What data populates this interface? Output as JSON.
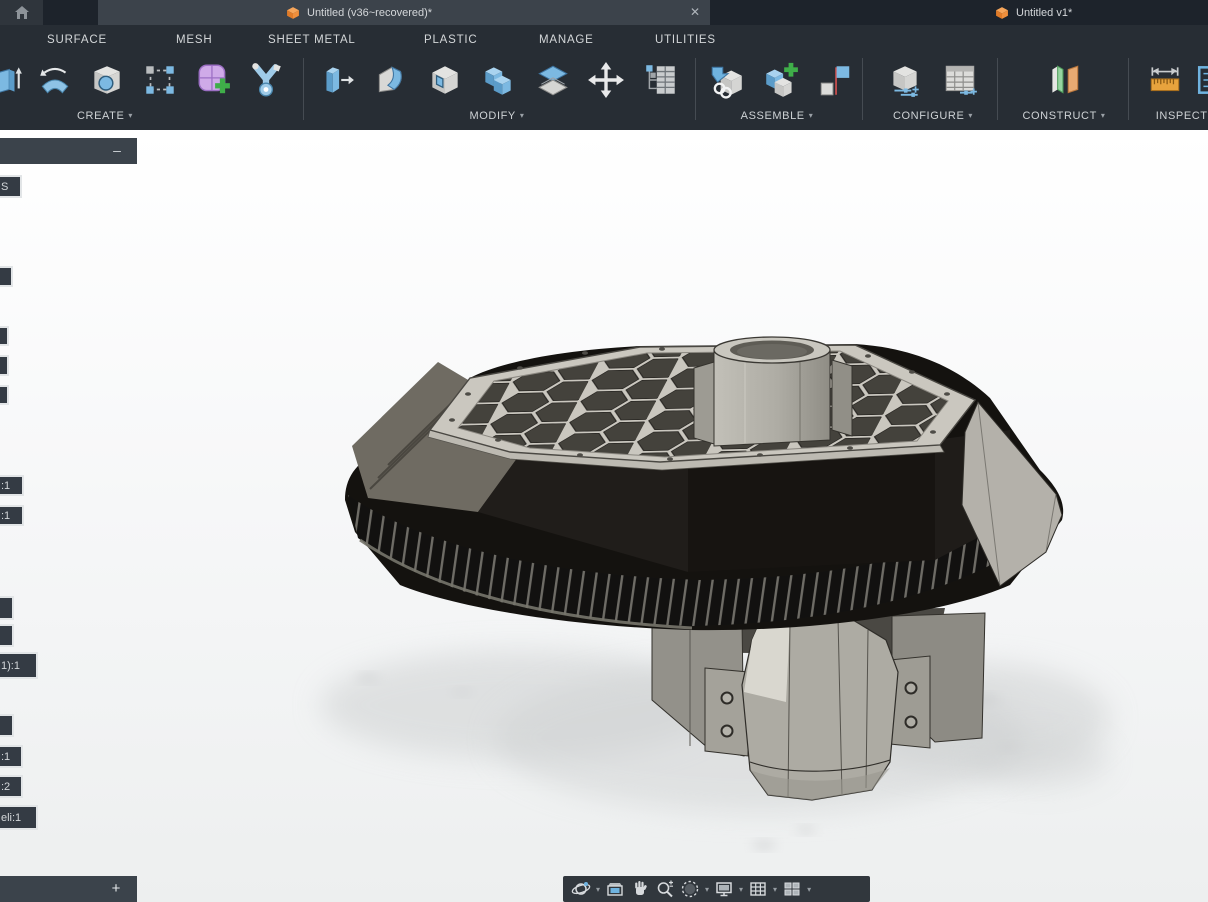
{
  "tabbar": {
    "tabs": [
      {
        "title": "Untitled (v36~recovered)*",
        "active": true,
        "close": "✕"
      },
      {
        "title": "Untitled v1*",
        "active": false
      }
    ]
  },
  "menubar": {
    "items": [
      "SURFACE",
      "MESH",
      "SHEET METAL",
      "PLASTIC",
      "MANAGE",
      "UTILITIES"
    ]
  },
  "toolbar": {
    "caret": "▾",
    "groups": [
      {
        "label": "CREATE",
        "icons": [
          "extrude-icon",
          "revolve-icon",
          "hole-icon",
          "rectangular-pattern-icon",
          "form-icon",
          "generative-design-icon"
        ]
      },
      {
        "label": "MODIFY",
        "icons": [
          "press-pull-icon",
          "fillet-icon",
          "shell-icon",
          "combine-icon",
          "offset-face-icon",
          "move-copy-icon",
          "change-parameters-icon"
        ]
      },
      {
        "label": "ASSEMBLE",
        "icons": [
          "insert-icon",
          "new-component-icon",
          "joint-icon"
        ]
      },
      {
        "label": "CONFIGURE",
        "icons": [
          "configure-icon",
          "configuration-table-icon"
        ]
      },
      {
        "label": "CONSTRUCT",
        "icons": [
          "construction-plane-icon"
        ]
      },
      {
        "label": "INSPECT",
        "icons": [
          "measure-icon",
          "section-analysis-icon"
        ]
      }
    ]
  },
  "browser": {
    "panel_minimize": "–",
    "timeline_add": "+",
    "fragments": [
      {
        "text": "S"
      },
      {
        "text": ""
      },
      {
        "text": ""
      },
      {
        "text": ""
      },
      {
        "text": ""
      },
      {
        "text": ":1"
      },
      {
        "text": ":1"
      },
      {
        "text": ""
      },
      {
        "text": ""
      },
      {
        "text": "1):1"
      },
      {
        "text": ""
      },
      {
        "text": ":1"
      },
      {
        "text": ":2"
      },
      {
        "text": "eli:1"
      }
    ]
  },
  "navbar": {
    "caret": "▾",
    "icons": [
      "orbit-icon",
      "look-at-icon",
      "pan-icon",
      "zoom-icon",
      "fit-icon",
      "display-settings-icon",
      "grid-settings-icon",
      "viewports-icon"
    ]
  },
  "colors": {
    "accent_blue": "#7cb9e2",
    "tabbar_bg": "#1d232b",
    "tab_active_bg": "#3c434b",
    "ribbon_bg": "#272d34",
    "panel_bg": "#3b434b",
    "viewport_bg": "#f5f6f7",
    "model_dark": "#171411",
    "model_plate": "#cac7bf",
    "model_gray": "#a5a29a",
    "doc_cube_orange": "#ef8f3c"
  }
}
